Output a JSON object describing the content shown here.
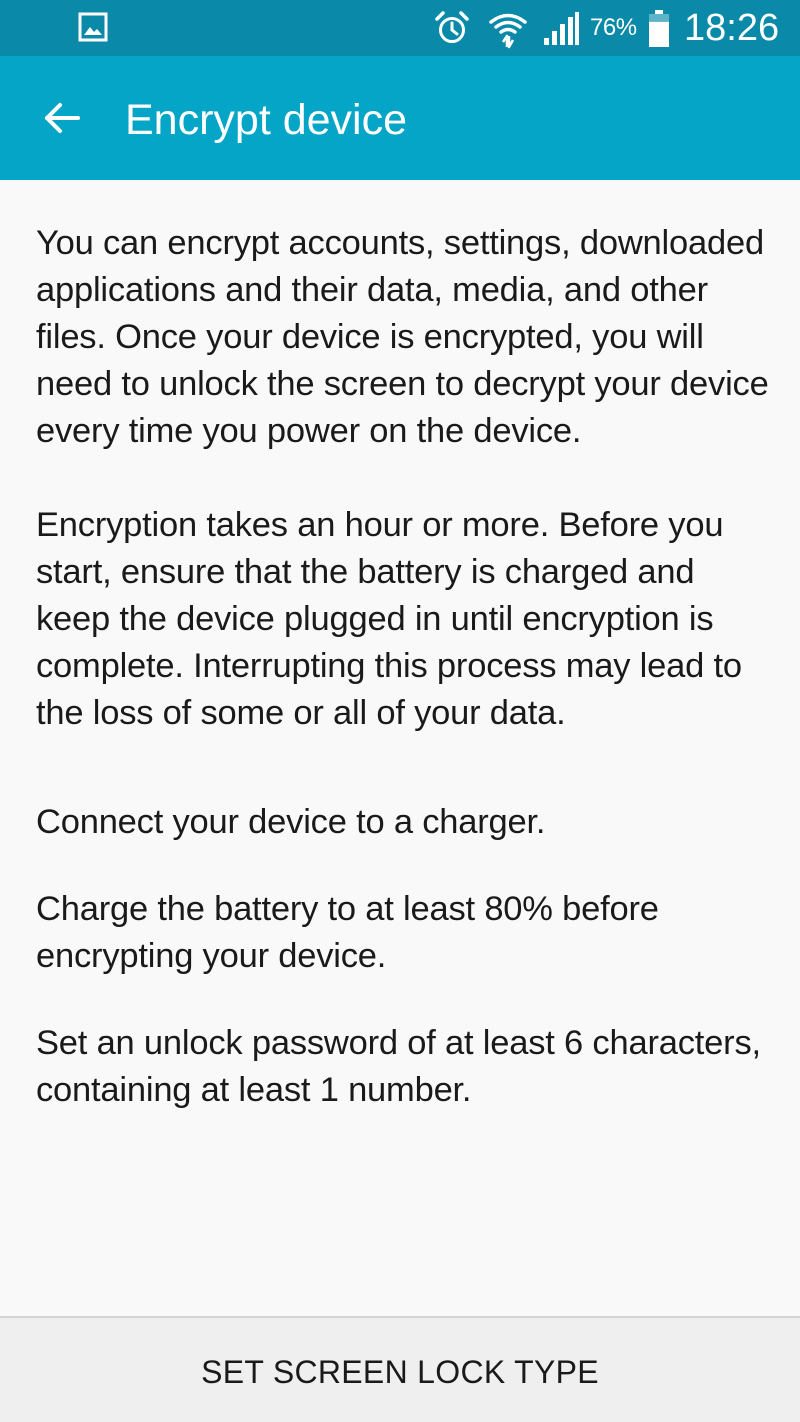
{
  "status_bar": {
    "notification_icon": "gallery-icon",
    "icons": [
      "alarm-icon",
      "wifi-icon",
      "signal-icon",
      "battery-icon"
    ],
    "battery_percent": "76%",
    "battery_level": 0.76,
    "time": "18:26"
  },
  "app_bar": {
    "back_icon": "back-arrow-icon",
    "title": "Encrypt device"
  },
  "content": {
    "paragraphs": [
      "You can encrypt accounts, settings, downloaded applications and their data, media, and other files. Once your device is encrypted, you will need to unlock the screen to decrypt your device every time you power on the device.",
      "Encryption takes an hour or more. Before you start, ensure that the battery is charged and keep the device plugged in until encryption is complete. Interrupting this process may lead to the loss of some or all of your data."
    ],
    "requirements": [
      "Connect your device to a charger.",
      "Charge the battery to at least 80% before encrypting your device.",
      "Set an unlock password of at least 6 characters, containing at least 1 number."
    ]
  },
  "bottom_bar": {
    "button_label": "SET SCREEN LOCK TYPE"
  },
  "colors": {
    "status_bar": "#0a8aa8",
    "app_bar": "#04a5c6",
    "background": "#f9f9f9",
    "text": "#1a1a1a",
    "bottom_bar": "#efefef"
  }
}
